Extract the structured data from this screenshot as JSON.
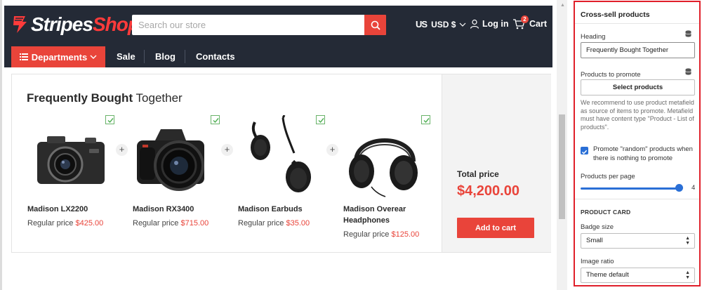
{
  "store": {
    "logo": {
      "part1": "Stripes",
      "part2": "Shop"
    },
    "search": {
      "placeholder": "Search our store"
    },
    "currency": {
      "flag": "US",
      "label": "USD $"
    },
    "account": {
      "login_label": "Log in"
    },
    "cart": {
      "label": "Cart",
      "count": "2"
    },
    "nav": {
      "departments_label": "Departments",
      "links": [
        "Sale",
        "Blog",
        "Contacts"
      ]
    }
  },
  "cross_sell": {
    "title_bold": "Frequently Bought",
    "title_rest": "Together",
    "products": [
      {
        "name": "Madison LX2200",
        "price_label": "Regular price",
        "price": "$425.00",
        "image": "compact-camera",
        "checked": true
      },
      {
        "name": "Madison RX3400",
        "price_label": "Regular price",
        "price": "$715.00",
        "image": "dslr-camera",
        "checked": true
      },
      {
        "name": "Madison Earbuds",
        "price_label": "Regular price",
        "price": "$35.00",
        "image": "earbuds",
        "checked": true
      },
      {
        "name": "Madison Overear Headphones",
        "price_label": "Regular price",
        "price": "$125.00",
        "image": "headphones",
        "checked": true
      }
    ],
    "total_label": "Total price",
    "total_price": "$4,200.00",
    "add_to_cart_label": "Add to cart"
  },
  "settings": {
    "title": "Cross-sell products",
    "heading_label": "Heading",
    "heading_value": "Frequently Bought Together",
    "promote_label": "Products to promote",
    "select_button": "Select products",
    "help_text": "We recommend to use product metafield as source of items to promote. Metafield must have content type \"Product - List of products\".",
    "random_checkbox_label": "Promote \"random\" products when there is nothing to promote",
    "random_checked": true,
    "per_page_label": "Products per page",
    "per_page_value": "4",
    "per_page_fraction": 1.0,
    "product_card_section": "PRODUCT CARD",
    "badge_size_label": "Badge size",
    "badge_size_value": "Small",
    "image_ratio_label": "Image ratio",
    "image_ratio_value": "Theme default"
  },
  "colors": {
    "accent": "#e9443a",
    "header_bg": "#242a36",
    "panel_highlight": "#e01f2a",
    "control_blue": "#2a6fd6"
  }
}
